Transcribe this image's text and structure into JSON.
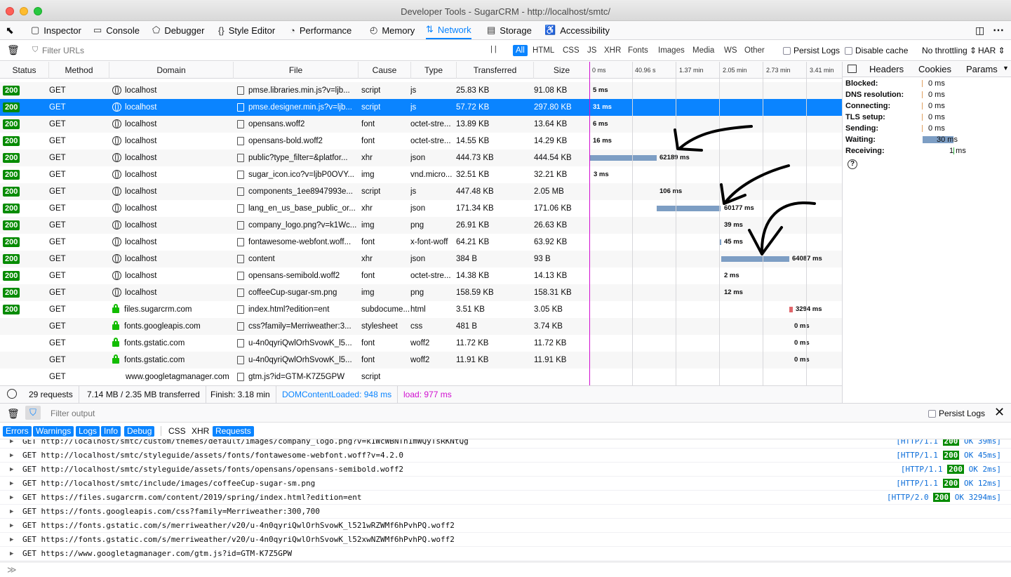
{
  "window": {
    "title": "Developer Tools - SugarCRM - http://localhost/smtc/"
  },
  "tools": [
    {
      "label": "Inspector",
      "icon": "inspector-icon"
    },
    {
      "label": "Console",
      "icon": "console-icon"
    },
    {
      "label": "Debugger",
      "icon": "debugger-icon"
    },
    {
      "label": "Style Editor",
      "icon": "style-editor-icon"
    },
    {
      "label": "Performance",
      "icon": "performance-icon"
    },
    {
      "label": "Memory",
      "icon": "memory-icon"
    },
    {
      "label": "Network",
      "icon": "network-icon",
      "selected": true
    },
    {
      "label": "Storage",
      "icon": "storage-icon"
    },
    {
      "label": "Accessibility",
      "icon": "accessibility-icon"
    }
  ],
  "filterbar": {
    "filter_placeholder": "Filter URLs",
    "pause": "| |",
    "types": [
      "All",
      "HTML",
      "CSS",
      "JS",
      "XHR",
      "Fonts",
      "Images",
      "Media",
      "WS",
      "Other"
    ],
    "active_type": "All",
    "persist_logs": "Persist Logs",
    "disable_cache": "Disable cache",
    "throttling": "No throttling ⇕",
    "har": "HAR ⇕"
  },
  "columns": {
    "status": "Status",
    "method": "Method",
    "domain": "Domain",
    "file": "File",
    "cause": "Cause",
    "type": "Type",
    "transferred": "Transferred",
    "size": "Size"
  },
  "waterfall_ticks": [
    "0 ms",
    "40.96 s",
    "1.37 min",
    "2.05 min",
    "2.73 min",
    "3.41 min"
  ],
  "requests": [
    {
      "status": "200",
      "method": "GET",
      "domain": "localhost",
      "secure": false,
      "file": "pmse.libraries.min.js?v=ljb...",
      "cause": "script",
      "type": "js",
      "transferred": "25.83 KB",
      "size": "91.08 KB",
      "timing": "5 ms"
    },
    {
      "status": "200",
      "method": "GET",
      "domain": "localhost",
      "secure": false,
      "file": "pmse.designer.min.js?v=ljb...",
      "cause": "script",
      "type": "js",
      "transferred": "57.72 KB",
      "size": "297.80 KB",
      "timing": "31 ms",
      "selected": true
    },
    {
      "status": "200",
      "method": "GET",
      "domain": "localhost",
      "secure": false,
      "file": "opensans.woff2",
      "cause": "font",
      "type": "octet-stre...",
      "transferred": "13.89 KB",
      "size": "13.64 KB",
      "timing": "6 ms"
    },
    {
      "status": "200",
      "method": "GET",
      "domain": "localhost",
      "secure": false,
      "file": "opensans-bold.woff2",
      "cause": "font",
      "type": "octet-stre...",
      "transferred": "14.55 KB",
      "size": "14.29 KB",
      "timing": "16 ms"
    },
    {
      "status": "200",
      "method": "GET",
      "domain": "localhost",
      "secure": false,
      "file": "public?type_filter=&platfor...",
      "cause": "xhr",
      "type": "json",
      "transferred": "444.73 KB",
      "size": "444.54 KB",
      "timing": "62189 ms"
    },
    {
      "status": "200",
      "method": "GET",
      "domain": "localhost",
      "secure": false,
      "file": "sugar_icon.ico?v=ljbP0OVY...",
      "cause": "img",
      "type": "vnd.micro...",
      "transferred": "32.51 KB",
      "size": "32.21 KB",
      "timing": "3 ms"
    },
    {
      "status": "200",
      "method": "GET",
      "domain": "localhost",
      "secure": false,
      "file": "components_1ee8947993e...",
      "cause": "script",
      "type": "js",
      "transferred": "447.48 KB",
      "size": "2.05 MB",
      "timing": "106 ms"
    },
    {
      "status": "200",
      "method": "GET",
      "domain": "localhost",
      "secure": false,
      "file": "lang_en_us_base_public_or...",
      "cause": "xhr",
      "type": "json",
      "transferred": "171.34 KB",
      "size": "171.06 KB",
      "timing": "60177 ms"
    },
    {
      "status": "200",
      "method": "GET",
      "domain": "localhost",
      "secure": false,
      "file": "company_logo.png?v=k1Wc...",
      "cause": "img",
      "type": "png",
      "transferred": "26.91 KB",
      "size": "26.63 KB",
      "timing": "39 ms"
    },
    {
      "status": "200",
      "method": "GET",
      "domain": "localhost",
      "secure": false,
      "file": "fontawesome-webfont.woff...",
      "cause": "font",
      "type": "x-font-woff",
      "transferred": "64.21 KB",
      "size": "63.92 KB",
      "timing": "45 ms"
    },
    {
      "status": "200",
      "method": "GET",
      "domain": "localhost",
      "secure": false,
      "file": "content",
      "cause": "xhr",
      "type": "json",
      "transferred": "384 B",
      "size": "93 B",
      "timing": "64087 ms"
    },
    {
      "status": "200",
      "method": "GET",
      "domain": "localhost",
      "secure": false,
      "file": "opensans-semibold.woff2",
      "cause": "font",
      "type": "octet-stre...",
      "transferred": "14.38 KB",
      "size": "14.13 KB",
      "timing": "2 ms"
    },
    {
      "status": "200",
      "method": "GET",
      "domain": "localhost",
      "secure": false,
      "file": "coffeeCup-sugar-sm.png",
      "cause": "img",
      "type": "png",
      "transferred": "158.59 KB",
      "size": "158.31 KB",
      "timing": "12 ms"
    },
    {
      "status": "200",
      "method": "GET",
      "domain": "files.sugarcrm.com",
      "secure": true,
      "file": "index.html?edition=ent",
      "cause": "subdocume...",
      "type": "html",
      "transferred": "3.51 KB",
      "size": "3.05 KB",
      "timing": "3294 ms"
    },
    {
      "status": "",
      "method": "GET",
      "domain": "fonts.googleapis.com",
      "secure": true,
      "file": "css?family=Merriweather:3...",
      "cause": "stylesheet",
      "type": "css",
      "transferred": "481 B",
      "size": "3.74 KB",
      "timing": "0 ms"
    },
    {
      "status": "",
      "method": "GET",
      "domain": "fonts.gstatic.com",
      "secure": true,
      "file": "u-4n0qyriQwlOrhSvowK_l5...",
      "cause": "font",
      "type": "woff2",
      "transferred": "11.72 KB",
      "size": "11.72 KB",
      "timing": "0 ms"
    },
    {
      "status": "",
      "method": "GET",
      "domain": "fonts.gstatic.com",
      "secure": true,
      "file": "u-4n0qyriQwlOrhSvowK_l5...",
      "cause": "font",
      "type": "woff2",
      "transferred": "11.91 KB",
      "size": "11.91 KB",
      "timing": "0 ms"
    },
    {
      "status": "",
      "method": "GET",
      "domain": "www.googletagmanager.com",
      "secure": false,
      "file": "gtm.js?id=GTM-K7Z5GPW",
      "cause": "script",
      "type": "",
      "transferred": "",
      "size": "",
      "timing": ""
    }
  ],
  "statusbar": {
    "requests": "29 requests",
    "transferred": "7.14 MB / 2.35 MB transferred",
    "finish": "Finish: 3.18 min",
    "dom": "DOMContentLoaded: 948 ms",
    "load": "load: 977 ms"
  },
  "sidepanel": {
    "tabs": [
      "Headers",
      "Cookies",
      "Params"
    ],
    "timings": [
      {
        "label": "Blocked:",
        "value": "0 ms"
      },
      {
        "label": "DNS resolution:",
        "value": "0 ms"
      },
      {
        "label": "Connecting:",
        "value": "0 ms"
      },
      {
        "label": "TLS setup:",
        "value": "0 ms"
      },
      {
        "label": "Sending:",
        "value": "0 ms"
      },
      {
        "label": "Waiting:",
        "value": "30 ms"
      },
      {
        "label": "Receiving:",
        "value": "1 ms"
      }
    ],
    "help": "?"
  },
  "console": {
    "filter_placeholder": "Filter output",
    "persist_logs": "Persist Logs",
    "levels": [
      "Errors",
      "Warnings",
      "Logs",
      "Info",
      "Debug"
    ],
    "categories": [
      "CSS",
      "XHR",
      "Requests"
    ],
    "active_categories": [
      "Requests"
    ],
    "prompt": "≫",
    "logs": [
      {
        "method": "GET",
        "url": "http://localhost/smtc/custom/themes/default/images/company_logo.png?v=k1WcWBNTh1mWQyTsRKNtQg",
        "proto": "[HTTP/1.1",
        "code": "200",
        "rest": "OK 39ms]"
      },
      {
        "method": "GET",
        "url": "http://localhost/smtc/styleguide/assets/fonts/fontawesome-webfont.woff?v=4.2.0",
        "proto": "[HTTP/1.1",
        "code": "200",
        "rest": "OK 45ms]"
      },
      {
        "method": "GET",
        "url": "http://localhost/smtc/styleguide/assets/fonts/opensans/opensans-semibold.woff2",
        "proto": "[HTTP/1.1",
        "code": "200",
        "rest": "OK 2ms]"
      },
      {
        "method": "GET",
        "url": "http://localhost/smtc/include/images/coffeeCup-sugar-sm.png",
        "proto": "[HTTP/1.1",
        "code": "200",
        "rest": "OK 12ms]"
      },
      {
        "method": "GET",
        "url": "https://files.sugarcrm.com/content/2019/spring/index.html?edition=ent",
        "proto": "[HTTP/2.0",
        "code": "200",
        "rest": "OK 3294ms]"
      },
      {
        "method": "GET",
        "url": "https://fonts.googleapis.com/css?family=Merriweather:300,700",
        "proto": "",
        "code": "",
        "rest": ""
      },
      {
        "method": "GET",
        "url": "https://fonts.gstatic.com/s/merriweather/v20/u-4n0qyriQwlOrhSvowK_l521wRZWMf6hPvhPQ.woff2",
        "proto": "",
        "code": "",
        "rest": ""
      },
      {
        "method": "GET",
        "url": "https://fonts.gstatic.com/s/merriweather/v20/u-4n0qyriQwlOrhSvowK_l52xwNZWMf6hPvhPQ.woff2",
        "proto": "",
        "code": "",
        "rest": ""
      },
      {
        "method": "GET",
        "url": "https://www.googletagmanager.com/gtm.js?id=GTM-K7Z5GPW",
        "proto": "",
        "code": "",
        "rest": ""
      }
    ]
  },
  "colors": {
    "accent": "#0a84ff",
    "ok_badge": "#058b00",
    "timing_bar": "#7d9ec4",
    "html_bar": "#e0666b",
    "dom_line": "#0a84ff",
    "load_line": "#d00ed0"
  }
}
